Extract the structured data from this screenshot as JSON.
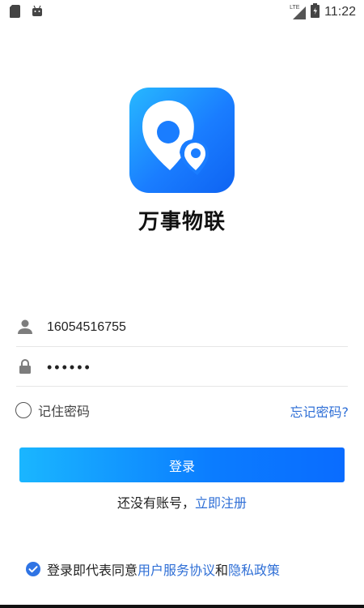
{
  "status_bar": {
    "time": "11:22",
    "network": "LTE",
    "icons": [
      "sd-card-icon",
      "android-icon",
      "signal-icon",
      "battery-icon"
    ]
  },
  "app": {
    "name": "万事物联",
    "logo_icon": "location-pins-icon",
    "logo_colors": [
      "#27b8ff",
      "#1a7dff",
      "#0e63f2"
    ]
  },
  "form": {
    "phone_value": "16054516755",
    "password_value": "••••••",
    "remember_label": "记住密码",
    "remember_checked": false,
    "forgot_label": "忘记密码?",
    "login_label": "登录"
  },
  "register": {
    "prompt": "还没有账号，",
    "link": "立即注册"
  },
  "agreement": {
    "checked": true,
    "prefix": "登录即代表同意",
    "user_agreement": "用户服务协议",
    "and": "和",
    "privacy_policy": "隐私政策"
  },
  "colors": {
    "accent": "#2f6fd6",
    "button_gradient_start": "#1ab6ff",
    "button_gradient_end": "#0a6cff"
  }
}
